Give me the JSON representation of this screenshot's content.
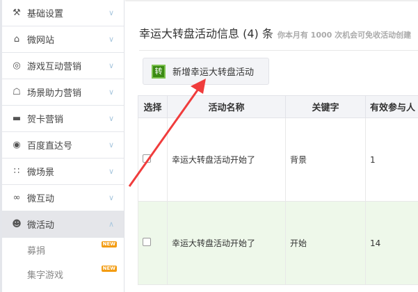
{
  "sidebar": {
    "items": [
      {
        "label": "基础设置",
        "icon": "tools-icon",
        "glyph": "⚒"
      },
      {
        "label": "微网站",
        "icon": "home-icon",
        "glyph": "⌂"
      },
      {
        "label": "游戏互动营销",
        "icon": "gamepad-icon",
        "glyph": "◎"
      },
      {
        "label": "场景助力营销",
        "icon": "bank-icon",
        "glyph": "☖"
      },
      {
        "label": "贺卡营销",
        "icon": "card-icon",
        "glyph": "▬"
      },
      {
        "label": "百度直达号",
        "icon": "user-circle-icon",
        "glyph": "◉"
      },
      {
        "label": "微场景",
        "icon": "cluster-icon",
        "glyph": "∷"
      },
      {
        "label": "微互动",
        "icon": "link-icon",
        "glyph": "∞"
      },
      {
        "label": "微活动",
        "icon": "activity-icon",
        "glyph": "☻"
      }
    ],
    "sub_items": [
      {
        "label": "募捐",
        "badge": "NEW"
      },
      {
        "label": "集字游戏",
        "badge": "NEW"
      }
    ]
  },
  "main": {
    "title": "幸运大转盘活动信息 (4) 条",
    "subtitle": "你本月有 1000 次机会可免收活动创建",
    "add_button": {
      "icon_text": "转",
      "label": "新增幸运大转盘活动"
    },
    "table": {
      "headers": [
        "选择",
        "活动名称",
        "关键字",
        "有效参与人"
      ],
      "rows": [
        {
          "name": "幸运大转盘活动开始了",
          "keyword": "背景",
          "count": "1"
        },
        {
          "name": "幸运大转盘活动开始了",
          "keyword": "开始",
          "count": "14"
        }
      ]
    }
  },
  "annotation_color": "#f03c3c"
}
